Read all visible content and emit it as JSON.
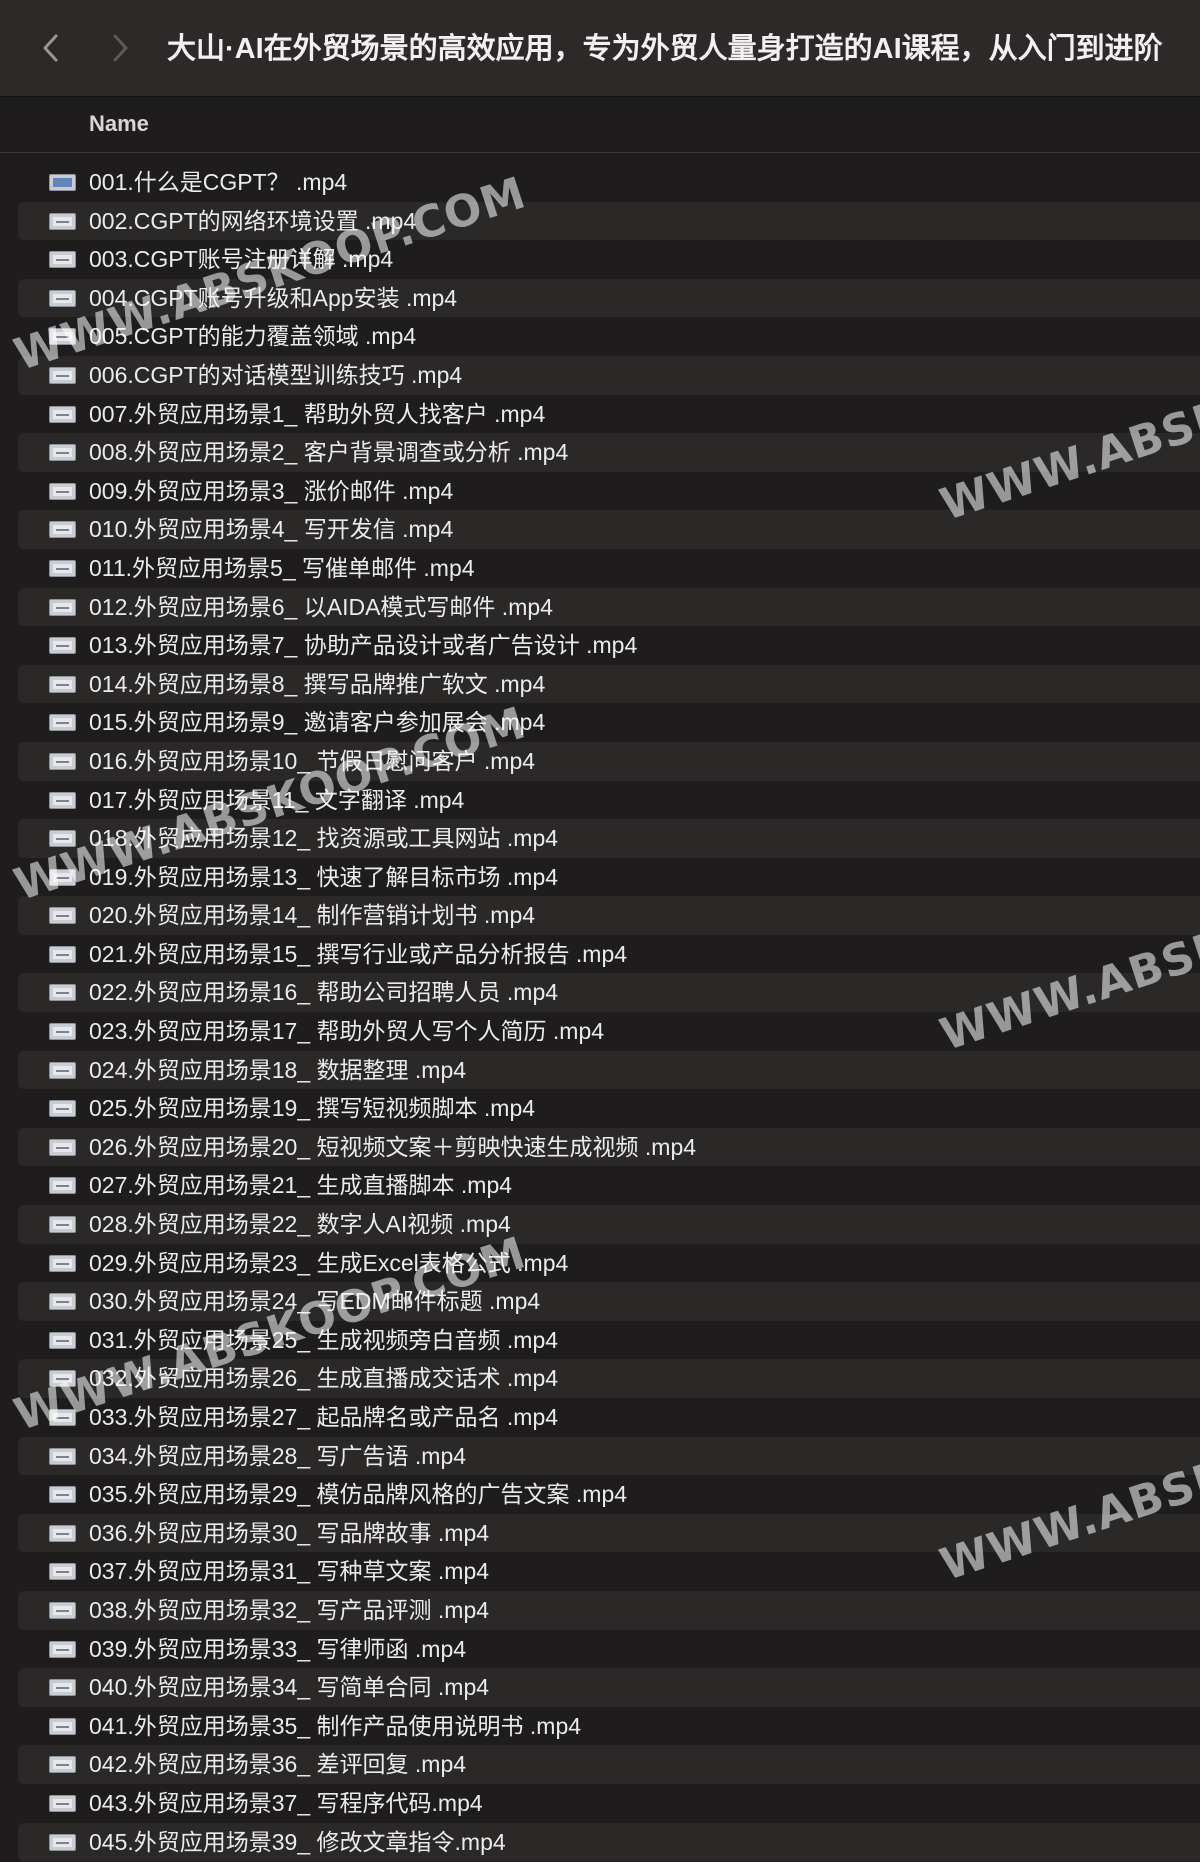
{
  "window": {
    "title": "大山·AI在外贸场景的高效应用，专为外贸人量身打造的AI课程，从入门到进阶"
  },
  "nav": {
    "back_icon": "chevron-left-icon",
    "forward_icon": "chevron-right-icon"
  },
  "columns": {
    "name": "Name"
  },
  "files": [
    "001.什么是CGPT？ .mp4",
    "002.CGPT的网络环境设置 .mp4",
    "003.CGPT账号注册详解 .mp4",
    "004.CGPT账号升级和App安装 .mp4",
    "005.CGPT的能力覆盖领域 .mp4",
    "006.CGPT的对话模型训练技巧 .mp4",
    "007.外贸应用场景1_ 帮助外贸人找客户 .mp4",
    "008.外贸应用场景2_ 客户背景调查或分析 .mp4",
    "009.外贸应用场景3_ 涨价邮件 .mp4",
    "010.外贸应用场景4_ 写开发信 .mp4",
    "011.外贸应用场景5_ 写催单邮件 .mp4",
    "012.外贸应用场景6_ 以AIDA模式写邮件 .mp4",
    "013.外贸应用场景7_ 协助产品设计或者广告设计 .mp4",
    "014.外贸应用场景8_ 撰写品牌推广软文 .mp4",
    "015.外贸应用场景9_ 邀请客户参加展会 .mp4",
    "016.外贸应用场景10_ 节假日慰问客户 .mp4",
    "017.外贸应用场景11_ 文字翻译 .mp4",
    "018.外贸应用场景12_ 找资源或工具网站 .mp4",
    "019.外贸应用场景13_ 快速了解目标市场 .mp4",
    "020.外贸应用场景14_ 制作营销计划书 .mp4",
    "021.外贸应用场景15_ 撰写行业或产品分析报告 .mp4",
    "022.外贸应用场景16_ 帮助公司招聘人员 .mp4",
    "023.外贸应用场景17_ 帮助外贸人写个人简历 .mp4",
    "024.外贸应用场景18_ 数据整理 .mp4",
    "025.外贸应用场景19_ 撰写短视频脚本 .mp4",
    "026.外贸应用场景20_ 短视频文案＋剪映快速生成视频 .mp4",
    "027.外贸应用场景21_ 生成直播脚本 .mp4",
    "028.外贸应用场景22_ 数字人AI视频 .mp4",
    "029.外贸应用场景23_ 生成Excel表格公式 .mp4",
    "030.外贸应用场景24_ 写EDM邮件标题 .mp4",
    "031.外贸应用场景25_ 生成视频旁白音频 .mp4",
    "032.外贸应用场景26_ 生成直播成交话术 .mp4",
    "033.外贸应用场景27_ 起品牌名或产品名 .mp4",
    "034.外贸应用场景28_ 写广告语 .mp4",
    "035.外贸应用场景29_ 模仿品牌风格的广告文案 .mp4",
    "036.外贸应用场景30_ 写品牌故事 .mp4",
    "037.外贸应用场景31_ 写种草文案 .mp4",
    "038.外贸应用场景32_ 写产品评测 .mp4",
    "039.外贸应用场景33_ 写律师函 .mp4",
    "040.外贸应用场景34_ 写简单合同 .mp4",
    "041.外贸应用场景35_ 制作产品使用说明书 .mp4",
    "042.外贸应用场景36_ 差评回复 .mp4",
    "043.外贸应用场景37_ 写程序代码.mp4",
    "045.外贸应用场景39_ 修改文章指令.mp4"
  ],
  "watermark": {
    "text_full": "WWW.ABSKOOP.COM",
    "text_clipped": "WWW.ABSKO"
  },
  "colors": {
    "background": "#1e1c1c",
    "titlebar": "#2c2929",
    "row_alt": "#2b2828",
    "text": "#ecebeb"
  }
}
